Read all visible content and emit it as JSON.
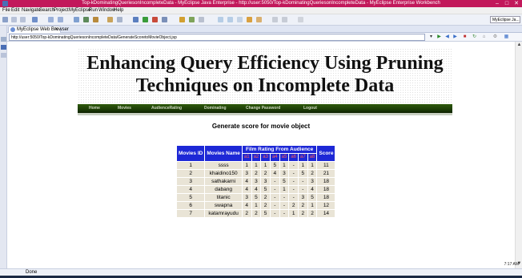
{
  "window": {
    "title": "Top-kDominatingQueriesonIncompleteData - MyEclipse Java Enterprise - http://user:5050/Top-kDominatingQueriesonIncompleteData - MyEclipse Enterprise Workbench",
    "controls": {
      "minimize": "–",
      "maximize": "□",
      "close": "✕"
    }
  },
  "menu": [
    "File",
    "Edit",
    "Navigate",
    "Search",
    "Project",
    "MyEclipse",
    "Run",
    "Window",
    "Help"
  ],
  "toolbar": {
    "perspective_label": "MyEclipse Ja..."
  },
  "editor": {
    "tab_label": "MyEclipse Web Browser",
    "tab_close": "✕",
    "url": "http://user:5050/Top-kDominatingQueriesonIncompleteData/GenerateScoretoMovieObject.jsp"
  },
  "page": {
    "header_line1": "Enhancing Query Efficiency Using Pruning",
    "header_line2": "Techniques on Incomplete Data",
    "nav": [
      "Home",
      "Movies",
      "AudienceRating",
      "Dominating",
      "Change Password",
      "Logout"
    ],
    "title": "Generate score for movie object"
  },
  "table": {
    "headers": {
      "id": "Movies ID",
      "name": "Movies Name",
      "rating": "Film Rating From Audience",
      "score": "Score"
    },
    "audience": [
      "a1",
      "a2",
      "a3",
      "a4",
      "a5",
      "a6",
      "a7",
      "a8"
    ],
    "rows": [
      {
        "id": "1",
        "name": "ssss",
        "ratings": [
          "1",
          "1",
          "1",
          "5",
          "1",
          "-",
          "1",
          "1"
        ],
        "score": "11"
      },
      {
        "id": "2",
        "name": "khaidino150",
        "ratings": [
          "3",
          "2",
          "2",
          "4",
          "3",
          "-",
          "5",
          "2"
        ],
        "score": "21"
      },
      {
        "id": "3",
        "name": "sathakarni",
        "ratings": [
          "4",
          "3",
          "3",
          "-",
          "5",
          "-",
          "-",
          "3"
        ],
        "score": "18"
      },
      {
        "id": "4",
        "name": "dabang",
        "ratings": [
          "4",
          "4",
          "5",
          "-",
          "1",
          "-",
          "-",
          "4"
        ],
        "score": "18"
      },
      {
        "id": "5",
        "name": "titanic",
        "ratings": [
          "3",
          "5",
          "2",
          "-",
          "-",
          "-",
          "3",
          "5"
        ],
        "score": "18"
      },
      {
        "id": "6",
        "name": "swapna",
        "ratings": [
          "4",
          "1",
          "2",
          "-",
          "-",
          "2",
          "2",
          "1"
        ],
        "score": "12"
      },
      {
        "id": "7",
        "name": "katamrayudu",
        "ratings": [
          "2",
          "2",
          "5",
          "-",
          "-",
          "1",
          "2",
          "2"
        ],
        "score": "14"
      }
    ]
  },
  "status": {
    "text": "Done"
  },
  "tray": {
    "time": "7:17 AM"
  },
  "colors": {
    "title_bar": "#c2185b",
    "table_header": "#1d28d6",
    "table_cell": "#e9e4d6",
    "nav_bar": "#1d3d06"
  }
}
